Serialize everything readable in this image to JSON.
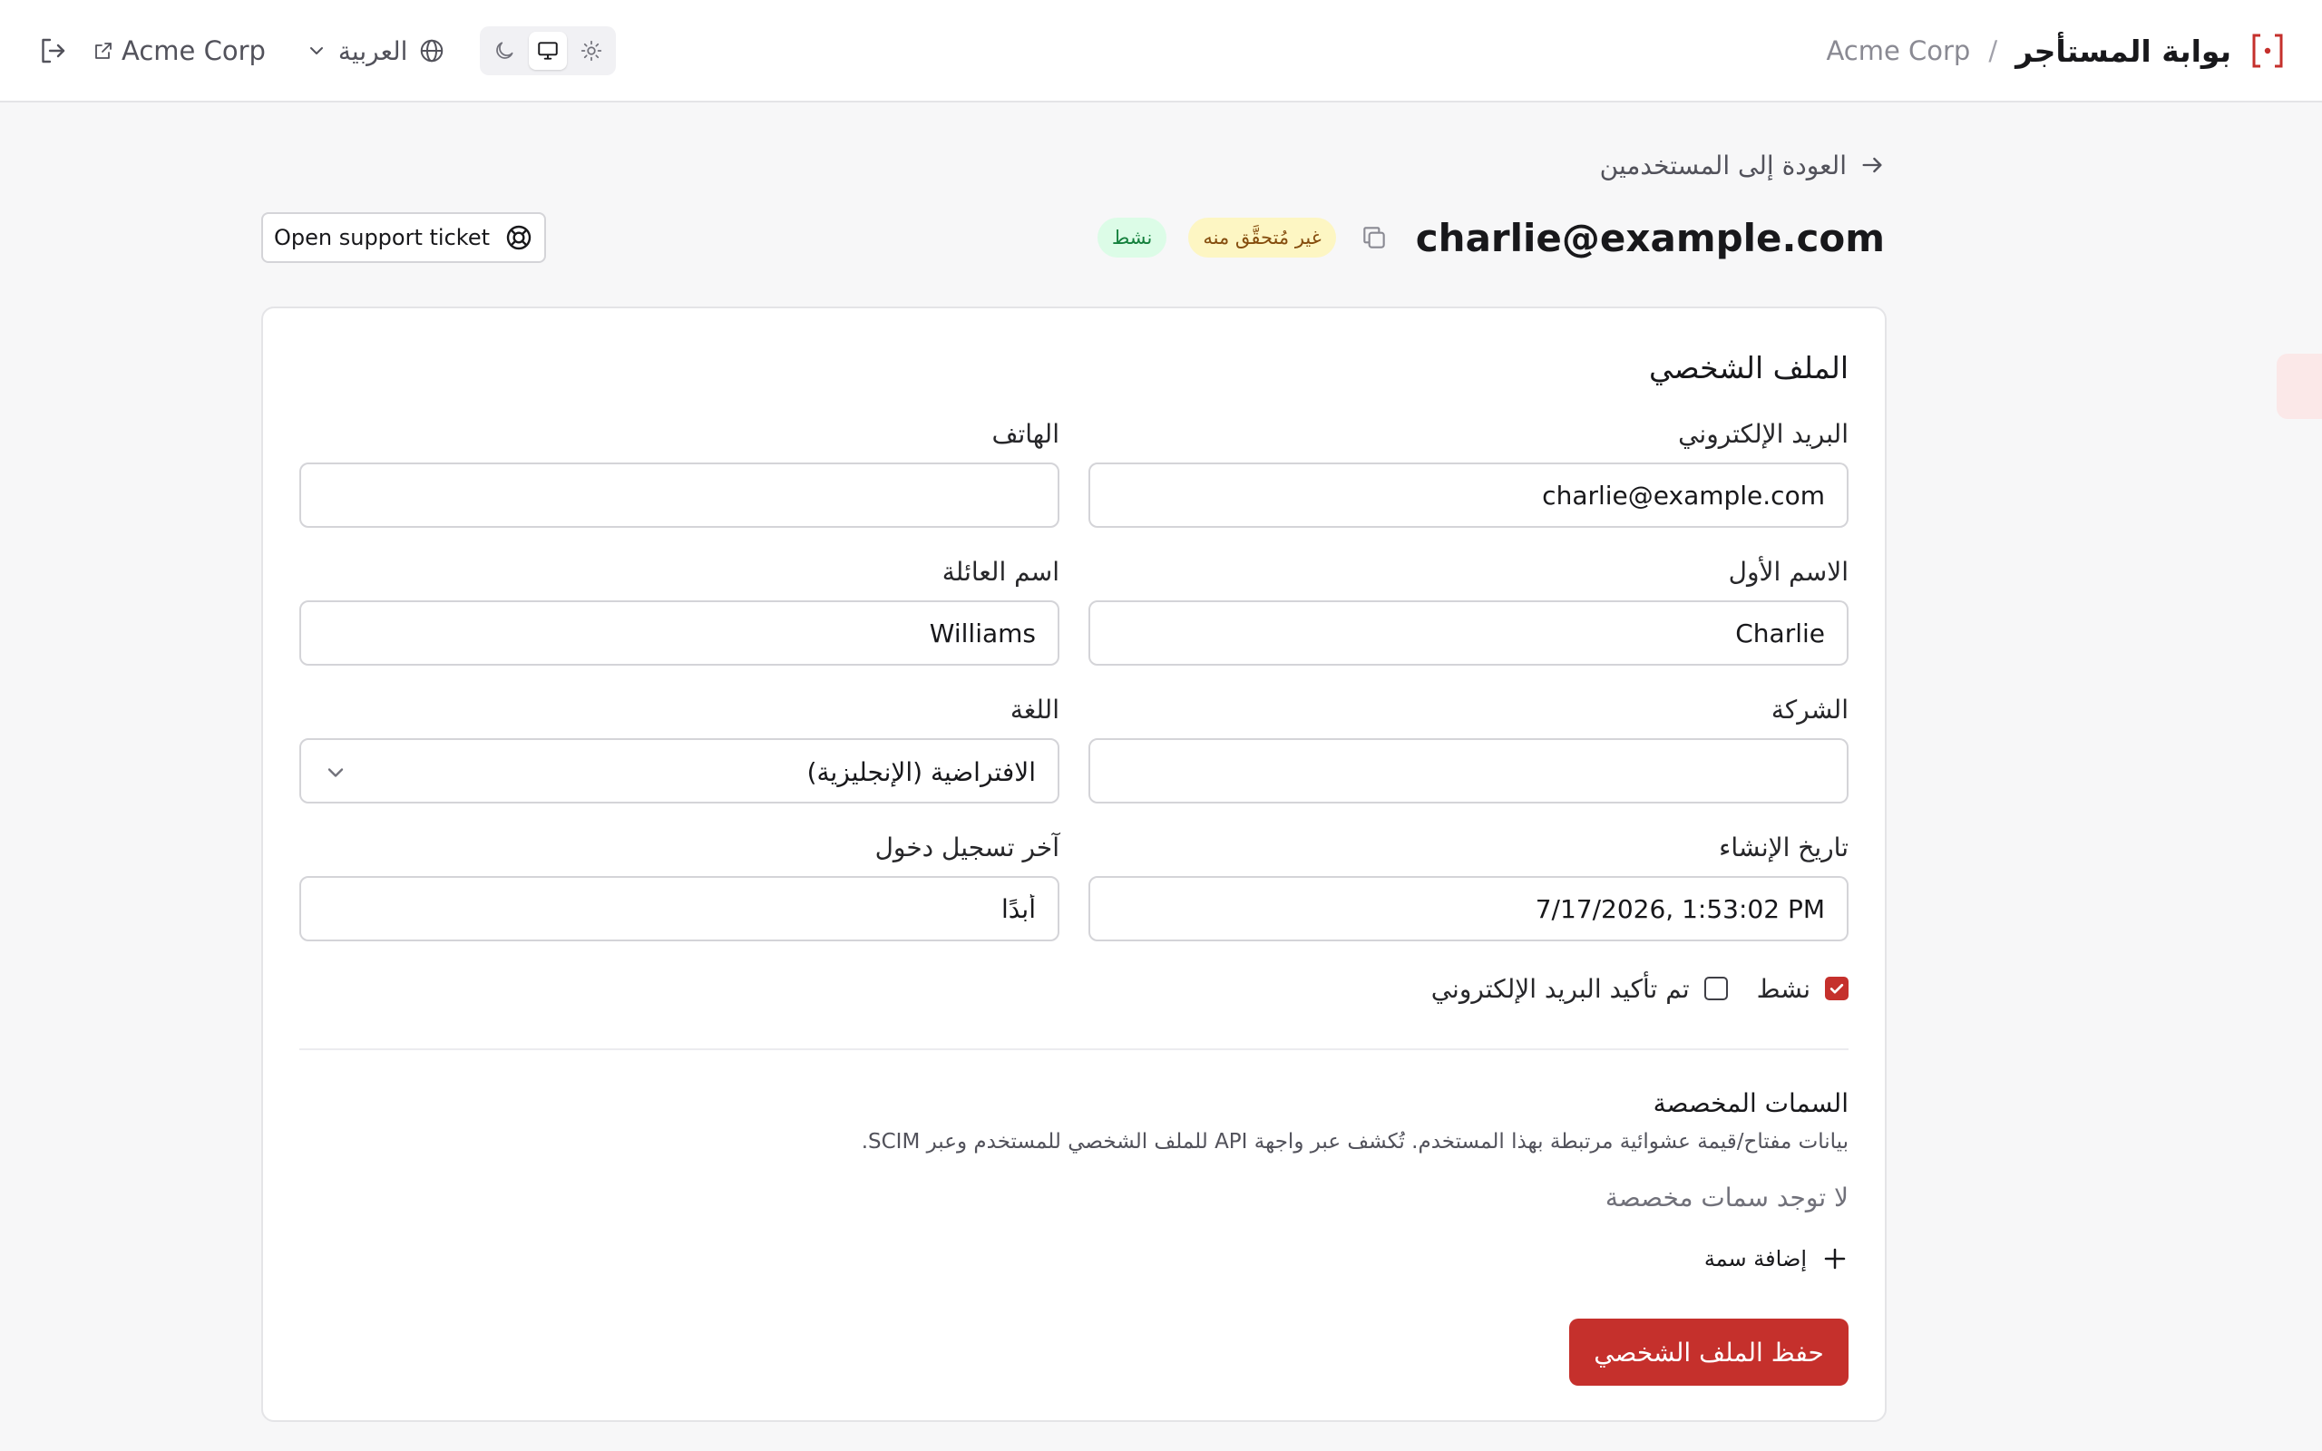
{
  "header": {
    "title": "بوابة المستأجر",
    "separator": "/",
    "org": "Acme Corp",
    "logo_icon": "bracket-logo-icon",
    "accent": "#c5302c"
  },
  "toolbar": {
    "org_link": "Acme Corp",
    "language": "العربية",
    "logout_icon": "logout-icon",
    "theme_modes": [
      "dark",
      "system",
      "light"
    ],
    "active_theme": "system"
  },
  "page": {
    "back_label": "العودة إلى المستخدمين",
    "user_email": "charlie@example.com",
    "badge_unverified": "غير مُتحقَّق منه",
    "badge_active": "نشط",
    "support_button": "Open support ticket"
  },
  "profile": {
    "section_title": "الملف الشخصي",
    "email": {
      "label": "البريد الإلكتروني",
      "value": "charlie@example.com"
    },
    "phone": {
      "label": "الهاتف",
      "value": ""
    },
    "first_name": {
      "label": "الاسم الأول",
      "value": "Charlie"
    },
    "last_name": {
      "label": "اسم العائلة",
      "value": "Williams"
    },
    "company": {
      "label": "الشركة",
      "value": ""
    },
    "language": {
      "label": "اللغة",
      "value": "الافتراضية (الإنجليزية)"
    },
    "created_at": {
      "label": "تاريخ الإنشاء",
      "value": "7/17/2026, 1:53:02 PM"
    },
    "last_login": {
      "label": "آخر تسجيل دخول",
      "value": "أبدًا"
    },
    "active_checkbox": {
      "label": "نشط",
      "checked": true
    },
    "email_verified_checkbox": {
      "label": "تم تأكيد البريد الإلكتروني",
      "checked": false
    }
  },
  "custom_attributes": {
    "title": "السمات المخصصة",
    "description": "بيانات مفتاح/قيمة عشوائية مرتبطة بهذا المستخدم. تُكشف عبر واجهة API للملف الشخصي للمستخدم وعبر SCIM.",
    "empty_text": "لا توجد سمات مخصصة",
    "add_label": "إضافة سمة"
  },
  "actions": {
    "save_label": "حفظ الملف الشخصي"
  }
}
